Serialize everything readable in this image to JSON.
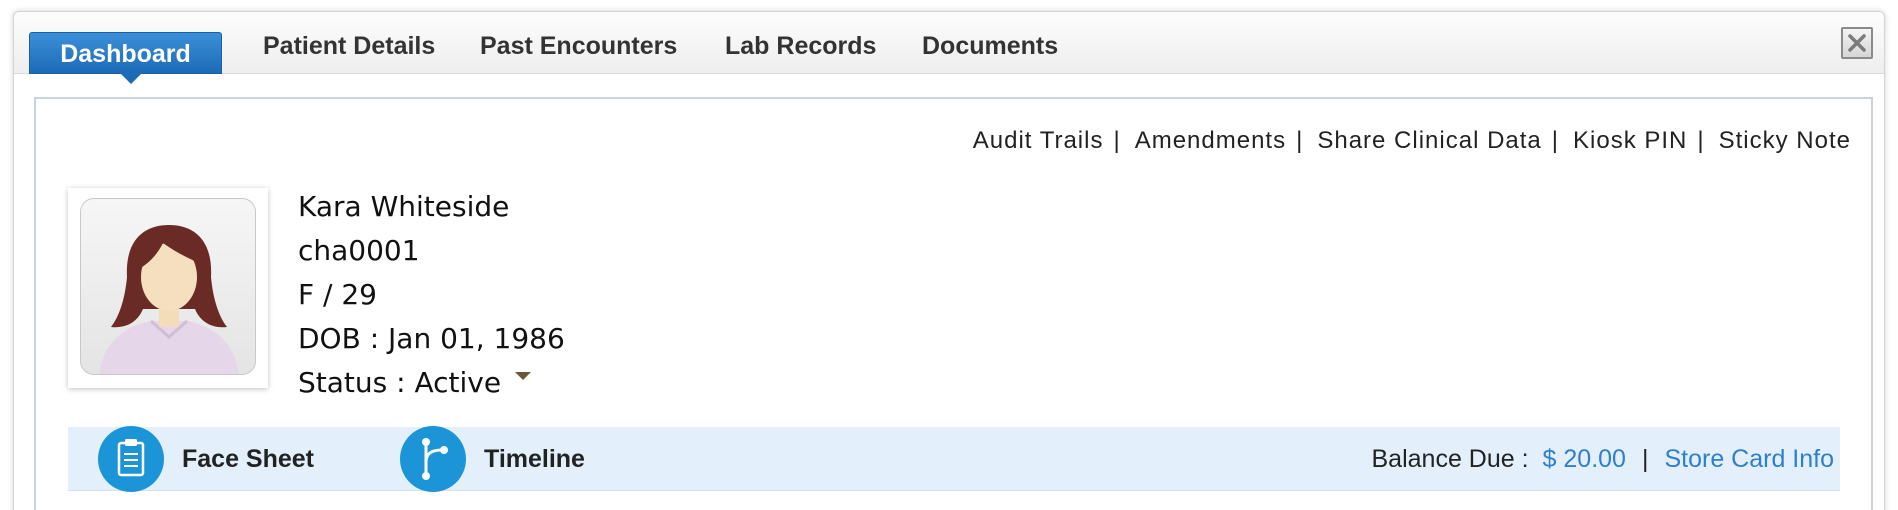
{
  "tabs": [
    {
      "label": "Dashboard",
      "active": true
    },
    {
      "label": "Patient Details",
      "active": false
    },
    {
      "label": "Past Encounters",
      "active": false
    },
    {
      "label": "Lab Records",
      "active": false
    },
    {
      "label": "Documents",
      "active": false
    }
  ],
  "top_links": [
    "Audit Trails",
    "Amendments",
    "Share Clinical Data",
    "Kiosk PIN",
    "Sticky Note"
  ],
  "patient": {
    "name": "Kara Whiteside",
    "id": "cha0001",
    "sex_age": "F / 29",
    "dob": "DOB : Jan 01, 1986",
    "status": "Status : Active"
  },
  "actions": {
    "face_sheet": "Face Sheet",
    "timeline": "Timeline"
  },
  "billing": {
    "balance_label": "Balance Due :",
    "balance_amount": "$ 20.00",
    "separator": "|",
    "store_card": "Store Card Info"
  },
  "icons": {
    "close": "close-icon",
    "face_sheet": "clipboard-icon",
    "timeline": "branch-icon",
    "status_dropdown": "caret-down-icon"
  },
  "colors": {
    "accent": "#1d6bb8",
    "bar_bg": "#e3f0fb",
    "icon_bg": "#1b95d8",
    "link": "#2f7fcf"
  }
}
